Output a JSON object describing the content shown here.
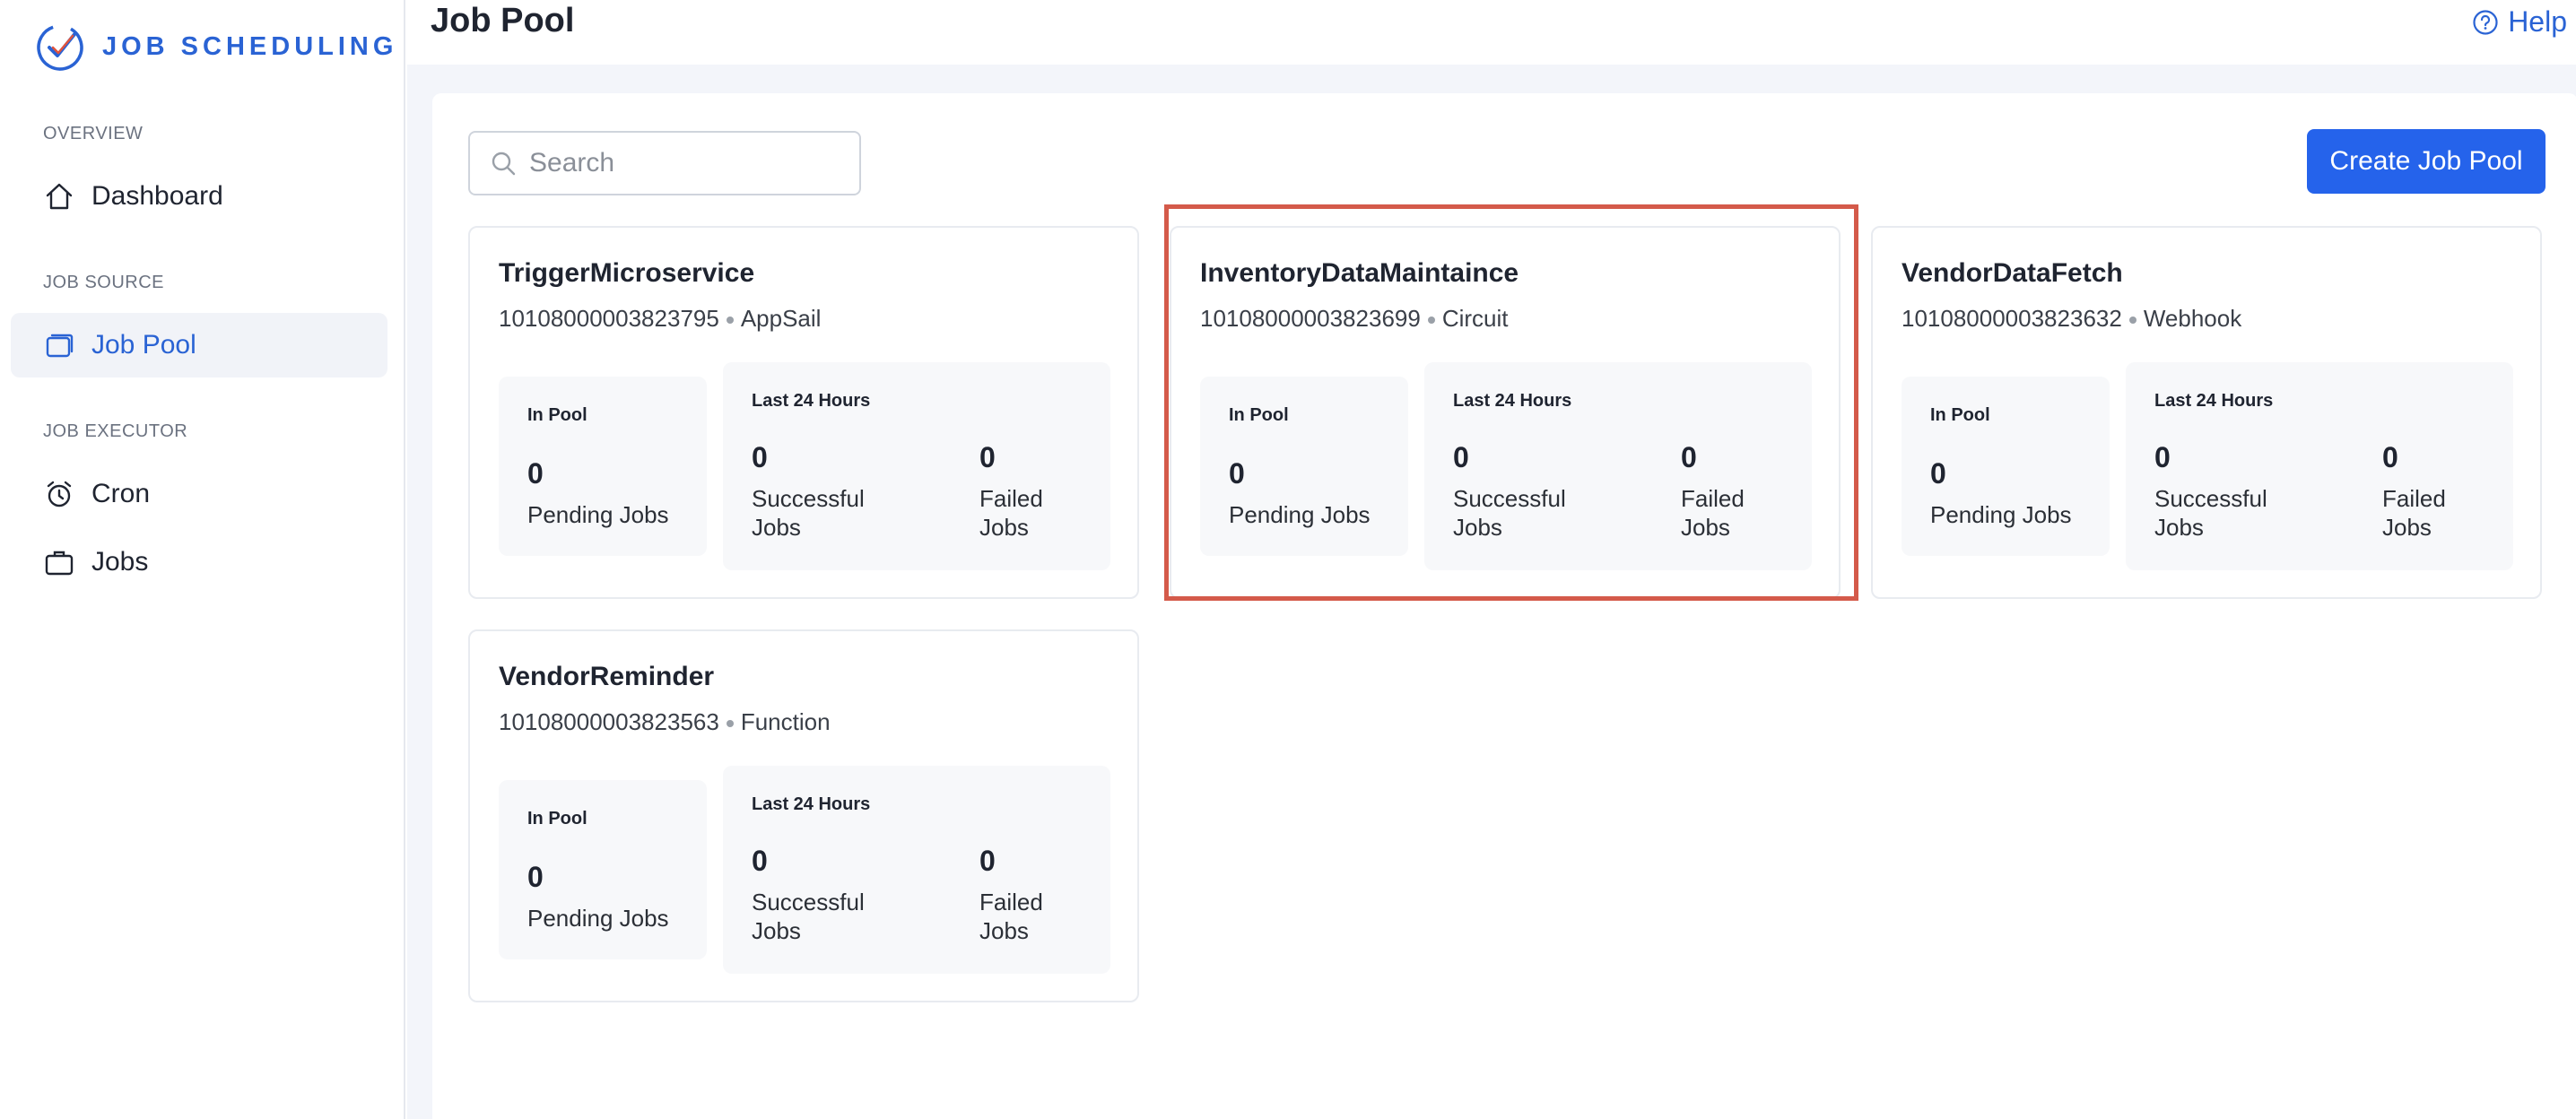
{
  "brand": {
    "name": "JOB SCHEDULING",
    "logo_icon": "check-circle-logo-icon",
    "color": "#2a63d4"
  },
  "sidebar": {
    "sections": [
      {
        "label": "OVERVIEW",
        "items": [
          {
            "label": "Dashboard",
            "icon": "home-icon",
            "active": false
          }
        ]
      },
      {
        "label": "JOB SOURCE",
        "items": [
          {
            "label": "Job Pool",
            "icon": "pool-icon",
            "active": true
          }
        ]
      },
      {
        "label": "JOB EXECUTOR",
        "items": [
          {
            "label": "Cron",
            "icon": "alarm-clock-icon",
            "active": false
          },
          {
            "label": "Jobs",
            "icon": "briefcase-icon",
            "active": false
          }
        ]
      }
    ]
  },
  "header": {
    "title": "Job Pool",
    "help_label": "Help"
  },
  "toolbar": {
    "search_placeholder": "Search",
    "search_value": "",
    "create_label": "Create Job Pool",
    "accent": "#2563eb"
  },
  "cards": [
    {
      "name": "TriggerMicroservice",
      "id": "10108000003823795",
      "type": "AppSail",
      "in_pool_label": "In Pool",
      "pending": "0",
      "pending_label": "Pending Jobs",
      "last24_label": "Last 24 Hours",
      "successful": "0",
      "successful_label": "Successful Jobs",
      "failed": "0",
      "failed_label": "Failed Jobs",
      "highlighted": false
    },
    {
      "name": "InventoryDataMaintaince",
      "id": "10108000003823699",
      "type": "Circuit",
      "in_pool_label": "In Pool",
      "pending": "0",
      "pending_label": "Pending Jobs",
      "last24_label": "Last 24 Hours",
      "successful": "0",
      "successful_label": "Successful Jobs",
      "failed": "0",
      "failed_label": "Failed Jobs",
      "highlighted": true
    },
    {
      "name": "VendorDataFetch",
      "id": "10108000003823632",
      "type": "Webhook",
      "in_pool_label": "In Pool",
      "pending": "0",
      "pending_label": "Pending Jobs",
      "last24_label": "Last 24 Hours",
      "successful": "0",
      "successful_label": "Successful Jobs",
      "failed": "0",
      "failed_label": "Failed Jobs",
      "highlighted": false
    },
    {
      "name": "VendorReminder",
      "id": "10108000003823563",
      "type": "Function",
      "in_pool_label": "In Pool",
      "pending": "0",
      "pending_label": "Pending Jobs",
      "last24_label": "Last 24 Hours",
      "successful": "0",
      "successful_label": "Successful Jobs",
      "failed": "0",
      "failed_label": "Failed Jobs",
      "highlighted": false
    }
  ],
  "highlight_color": "#d45a4a"
}
